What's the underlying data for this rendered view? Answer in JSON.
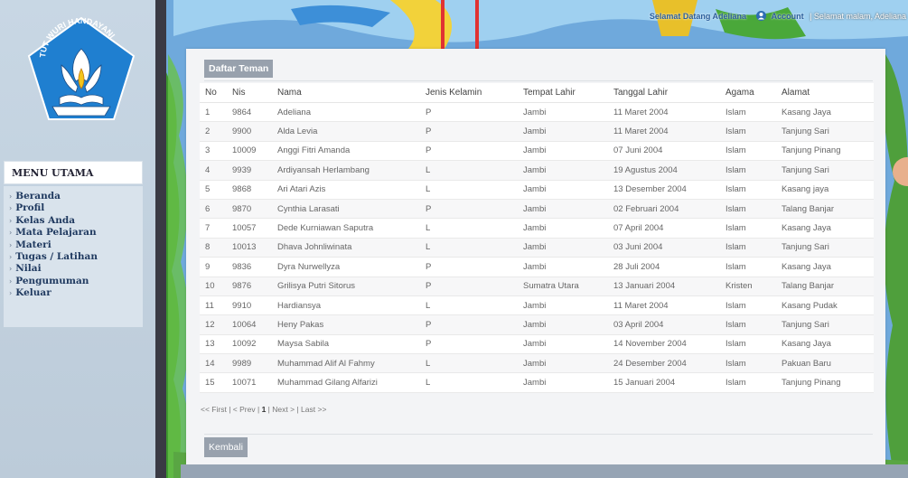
{
  "sidebar": {
    "logo_text": "TUT WURI HANDAYANI",
    "menu_title": "MENU UTAMA",
    "items": [
      {
        "label": "Beranda"
      },
      {
        "label": "Profil"
      },
      {
        "label": "Kelas Anda"
      },
      {
        "label": "Mata Pelajaran"
      },
      {
        "label": "Materi"
      },
      {
        "label": "Tugas / Latihan"
      },
      {
        "label": "Nilai"
      },
      {
        "label": "Pengumuman"
      },
      {
        "label": "Keluar"
      }
    ]
  },
  "topbar": {
    "welcome": "Selamat Datang Adeliana",
    "account": "Account",
    "greeting": "| Selamat malam, Adeliana"
  },
  "panel": {
    "title": "Daftar Teman",
    "columns": [
      "No",
      "Nis",
      "Nama",
      "Jenis Kelamin",
      "Tempat Lahir",
      "Tanggal Lahir",
      "Agama",
      "Alamat"
    ],
    "rows": [
      [
        "1",
        "9864",
        "Adeliana",
        "P",
        "Jambi",
        "11 Maret 2004",
        "Islam",
        "Kasang Jaya"
      ],
      [
        "2",
        "9900",
        "Alda Levia",
        "P",
        "Jambi",
        "11 Maret 2004",
        "Islam",
        "Tanjung Sari"
      ],
      [
        "3",
        "10009",
        "Anggi Fitri Amanda",
        "P",
        "Jambi",
        "07 Juni 2004",
        "Islam",
        "Tanjung Pinang"
      ],
      [
        "4",
        "9939",
        "Ardiyansah Herlambang",
        "L",
        "Jambi",
        "19 Agustus 2004",
        "Islam",
        "Tanjung Sari"
      ],
      [
        "5",
        "9868",
        "Ari Atari Azis",
        "L",
        "Jambi",
        "13 Desember 2004",
        "Islam",
        "Kasang jaya"
      ],
      [
        "6",
        "9870",
        "Cynthia Larasati",
        "P",
        "Jambi",
        "02 Februari 2004",
        "Islam",
        "Talang Banjar"
      ],
      [
        "7",
        "10057",
        "Dede Kurniawan Saputra",
        "L",
        "Jambi",
        "07 April 2004",
        "Islam",
        "Kasang Jaya"
      ],
      [
        "8",
        "10013",
        "Dhava Johnliwinata",
        "L",
        "Jambi",
        "03 Juni 2004",
        "Islam",
        "Tanjung Sari"
      ],
      [
        "9",
        "9836",
        "Dyra Nurwellyza",
        "P",
        "Jambi",
        "28 Juli 2004",
        "Islam",
        "Kasang Jaya"
      ],
      [
        "10",
        "9876",
        "Grilisya Putri Sitorus",
        "P",
        "Sumatra Utara",
        "13 Januari 2004",
        "Kristen",
        "Talang Banjar"
      ],
      [
        "11",
        "9910",
        "Hardiansya",
        "L",
        "Jambi",
        "11 Maret 2004",
        "Islam",
        "Kasang Pudak"
      ],
      [
        "12",
        "10064",
        "Heny Pakas",
        "P",
        "Jambi",
        "03 April 2004",
        "Islam",
        "Tanjung Sari"
      ],
      [
        "13",
        "10092",
        "Maysa Sabila",
        "P",
        "Jambi",
        "14 November 2004",
        "Islam",
        "Kasang Jaya"
      ],
      [
        "14",
        "9989",
        "Muhammad Alif Al Fahmy",
        "L",
        "Jambi",
        "24 Desember 2004",
        "Islam",
        "Pakuan Baru"
      ],
      [
        "15",
        "10071",
        "Muhammad Gilang Alfarizi",
        "L",
        "Jambi",
        "15 Januari 2004",
        "Islam",
        "Tanjung Pinang"
      ]
    ],
    "pager": {
      "first": "<< First",
      "prev": "< Prev",
      "page": "1",
      "next": "Next >",
      "last": "Last >>",
      "sep": "|"
    },
    "back_label": "Kembali"
  },
  "colors": {
    "header_bg": "#98a1ad",
    "sidebar_bg": "#c8d7e4",
    "menu_text": "#203a60",
    "logo_blue": "#1f7fd0",
    "logo_yellow": "#f4c51b"
  }
}
